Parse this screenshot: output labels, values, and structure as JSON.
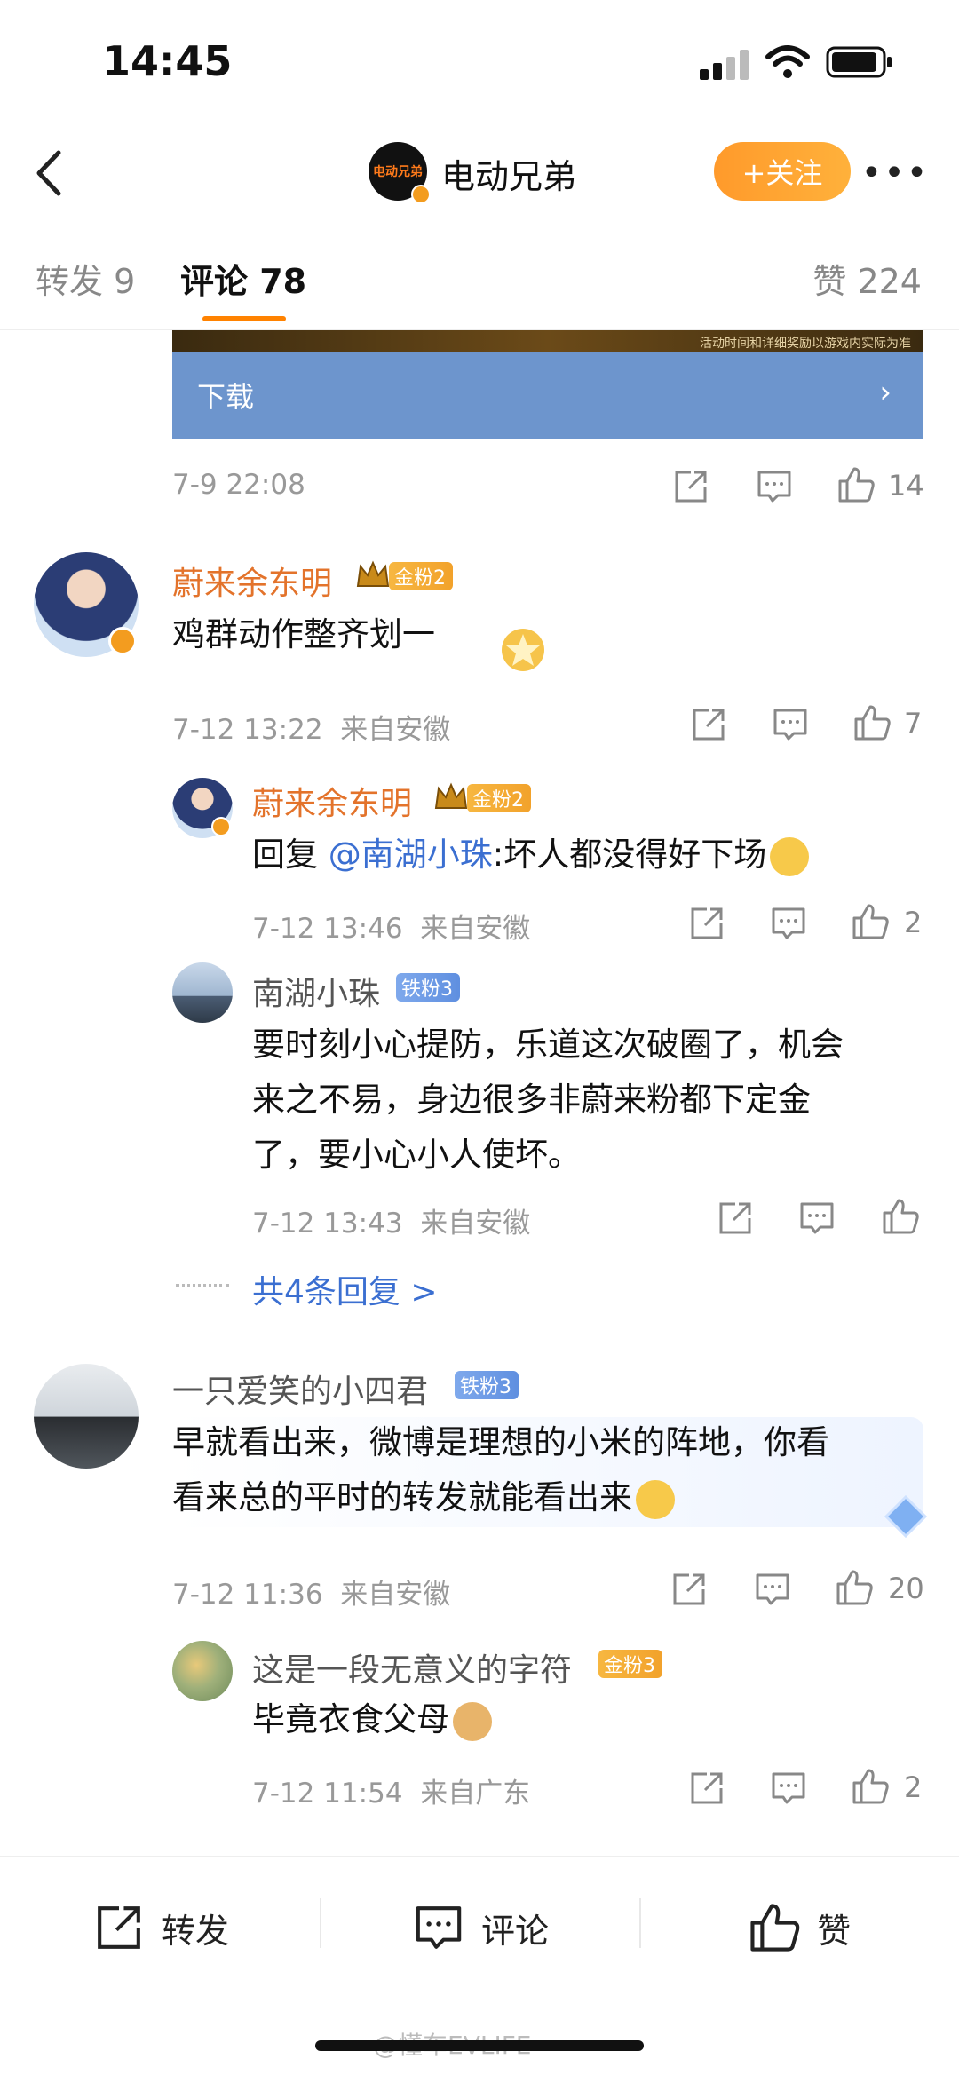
{
  "status": {
    "time": "14:45"
  },
  "header": {
    "title": "电动兄弟",
    "avatar_text": "电动兄弟",
    "follow_label": "+关注",
    "more_label": "•••"
  },
  "tabs": [
    {
      "label": "转发 9"
    },
    {
      "label": "评论 78"
    },
    {
      "label": "赞 224"
    }
  ],
  "banner": {
    "notice": "活动时间和详细奖励以游戏内实际为准",
    "download_label": "下载",
    "chevron": "›"
  },
  "post": {
    "time": "7-9 22:08",
    "likes": "14"
  },
  "comments": [
    {
      "name": "蔚来余东明",
      "badge": "金粉2",
      "text": "鸡群动作整齐划一",
      "time": "7-12 13:22",
      "location": "来自安徽",
      "likes": "7",
      "replies": [
        {
          "name": "蔚来余东明",
          "badge": "金粉2",
          "prefix": "回复 ",
          "mention": "@南湖小珠",
          "text": ":坏人都没得好下场",
          "time": "7-12 13:46",
          "location": "来自安徽",
          "likes": "2"
        },
        {
          "name": "南湖小珠",
          "badge": "铁粉3",
          "text_lines": [
            "要时刻小心提防，乐道这次破圈了，机会",
            "来之不易，身边很多非蔚来粉都下定金",
            "了，要小心小人使坏。"
          ],
          "time": "7-12 13:43",
          "location": "来自安徽",
          "likes": ""
        }
      ],
      "more_replies": "共4条回复 >"
    },
    {
      "name": "一只爱笑的小四君",
      "badge": "铁粉3",
      "text_lines": [
        "早就看出来，微博是理想的小米的阵地，你看",
        "看来总的平时的转发就能看出来"
      ],
      "time": "7-12 11:36",
      "location": "来自安徽",
      "likes": "20",
      "replies": [
        {
          "name": "这是一段无意义的字符",
          "badge": "金粉3",
          "text": "毕竟衣食父母",
          "time": "7-12 11:54",
          "location": "来自广东",
          "likes": "2"
        }
      ]
    }
  ],
  "bottom_bar": {
    "repost": "转发",
    "comment": "评论",
    "like": "赞"
  },
  "watermark": "@懂车EVLIFE",
  "colors": {
    "accent": "#ff8200",
    "name_orange": "#e3732b",
    "link_blue": "#3b6fd1",
    "banner_blue": "#6d95cd"
  }
}
